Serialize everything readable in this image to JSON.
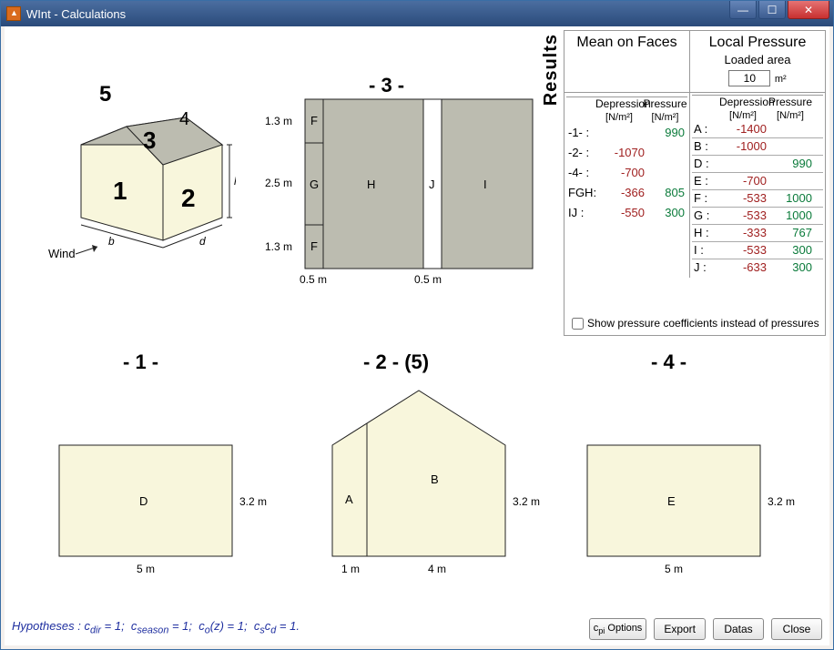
{
  "window": {
    "title": "WInt - Calculations"
  },
  "results": {
    "sidebar_label": "Results",
    "mean_label": "Mean on Faces",
    "local_label": "Local Pressure",
    "loaded_area_label": "Loaded area",
    "loaded_area_value": "10",
    "loaded_area_unit": "m²",
    "depression_label": "Depression",
    "pressure_label": "Pressure",
    "unit": "[N/m²]",
    "mean_rows": [
      {
        "lbl": "-1- :",
        "dep": "",
        "pre": "990"
      },
      {
        "lbl": "-2- :",
        "dep": "-1070",
        "pre": ""
      },
      {
        "lbl": "-4- :",
        "dep": "-700",
        "pre": ""
      },
      {
        "lbl": "FGH:",
        "dep": "-366",
        "pre": "805"
      },
      {
        "lbl": "IJ :",
        "dep": "-550",
        "pre": "300"
      }
    ],
    "local_rows": [
      {
        "lbl": "A :",
        "dep": "-1400",
        "pre": ""
      },
      {
        "lbl": "B :",
        "dep": "-1000",
        "pre": ""
      },
      {
        "lbl": "D :",
        "dep": "",
        "pre": "990"
      },
      {
        "lbl": "E :",
        "dep": "-700",
        "pre": ""
      },
      {
        "lbl": "F :",
        "dep": "-533",
        "pre": "1000"
      },
      {
        "lbl": "G :",
        "dep": "-533",
        "pre": "1000"
      },
      {
        "lbl": "H :",
        "dep": "-333",
        "pre": "767"
      },
      {
        "lbl": "I :",
        "dep": "-533",
        "pre": "300"
      },
      {
        "lbl": "J :",
        "dep": "-633",
        "pre": "300"
      }
    ],
    "show_coef_label": "Show pressure coefficients instead of pressures"
  },
  "house": {
    "face1": "1",
    "face2": "2",
    "face3": "3",
    "face4": "4",
    "face5": "5",
    "wind": "Wind",
    "b": "b",
    "d": "d",
    "h": "h"
  },
  "diag3": {
    "title": "- 3 -",
    "F": "F",
    "G": "G",
    "H": "H",
    "J": "J",
    "I": "I",
    "h1": "1.3 m",
    "h2": "2.5 m",
    "h3": "1.3 m",
    "w1": "0.5 m",
    "w2": "0.5 m"
  },
  "diag1": {
    "title": "- 1 -",
    "D": "D",
    "h": "3.2 m",
    "w": "5 m"
  },
  "diag2": {
    "title": "- 2 - (5)",
    "A": "A",
    "B": "B",
    "h": "3.2 m",
    "w1": "1 m",
    "w2": "4 m"
  },
  "diag4": {
    "title": "- 4 -",
    "E": "E",
    "h": "3.2 m",
    "w": "5 m"
  },
  "hypotheses_text": "Hypotheses : c_dir = 1;  c_season = 1;  c_o(z) = 1;  c_s c_d = 1.",
  "buttons": {
    "cpi": "c_pi Options",
    "export": "Export",
    "datas": "Datas",
    "close": "Close"
  }
}
